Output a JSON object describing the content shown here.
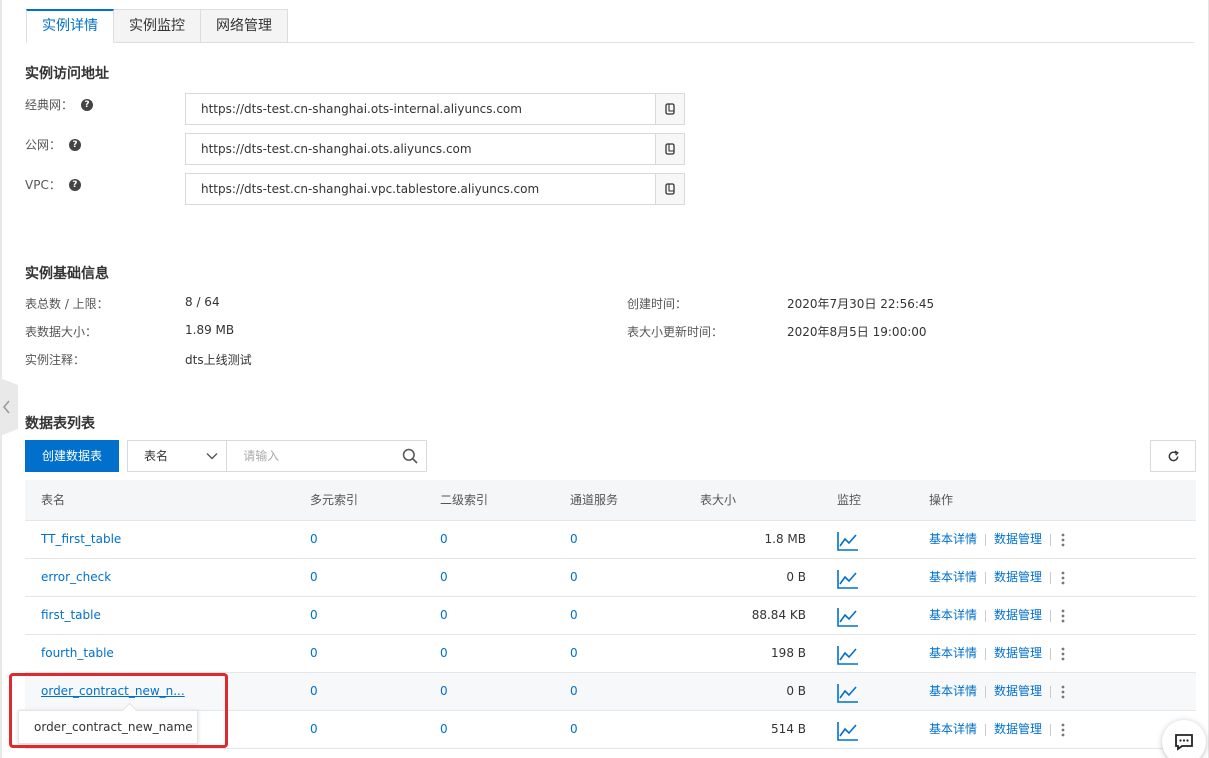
{
  "tabs": [
    {
      "label": "实例详情",
      "active": true
    },
    {
      "label": "实例监控",
      "active": false
    },
    {
      "label": "网络管理",
      "active": false
    }
  ],
  "access": {
    "title": "实例访问地址",
    "rows": [
      {
        "label": "经典网：",
        "url": "https://dts-test.cn-shanghai.ots-internal.aliyuncs.com"
      },
      {
        "label": "公网：",
        "url": "https://dts-test.cn-shanghai.ots.aliyuncs.com"
      },
      {
        "label": "VPC：",
        "url": "https://dts-test.cn-shanghai.vpc.tablestore.aliyuncs.com"
      }
    ]
  },
  "basic": {
    "title": "实例基础信息",
    "table_count_label": "表总数 / 上限：",
    "table_count_value": "8 / 64",
    "data_size_label": "表数据大小：",
    "data_size_value": "1.89 MB",
    "note_label": "实例注释：",
    "note_value": "dts上线测试",
    "created_label": "创建时间：",
    "created_value": "2020年7月30日 22:56:45",
    "size_updated_label": "表大小更新时间：",
    "size_updated_value": "2020年8月5日 19:00:00"
  },
  "tables": {
    "title": "数据表列表",
    "create_button": "创建数据表",
    "filter_select": "表名",
    "search_placeholder": "请输入",
    "headers": {
      "name": "表名",
      "multi_index": "多元索引",
      "secondary_index": "二级索引",
      "tunnel": "通道服务",
      "size": "表大小",
      "monitor": "监控",
      "actions": "操作"
    },
    "action_detail": "基本详情",
    "action_data": "数据管理",
    "rows": [
      {
        "name": "TT_first_table",
        "multi": "0",
        "secondary": "0",
        "tunnel": "0",
        "size": "1.8 MB"
      },
      {
        "name": "error_check",
        "multi": "0",
        "secondary": "0",
        "tunnel": "0",
        "size": "0 B"
      },
      {
        "name": "first_table",
        "multi": "0",
        "secondary": "0",
        "tunnel": "0",
        "size": "88.84 KB"
      },
      {
        "name": "fourth_table",
        "multi": "0",
        "secondary": "0",
        "tunnel": "0",
        "size": "198 B"
      },
      {
        "name": "order_contract_new_n...",
        "multi": "0",
        "secondary": "0",
        "tunnel": "0",
        "size": "0 B"
      },
      {
        "name": "",
        "multi": "0",
        "secondary": "0",
        "tunnel": "0",
        "size": "514 B"
      }
    ],
    "tooltip": "order_contract_new_name"
  },
  "colors": {
    "accent": "#0070cc",
    "highlight": "#e0282f"
  }
}
